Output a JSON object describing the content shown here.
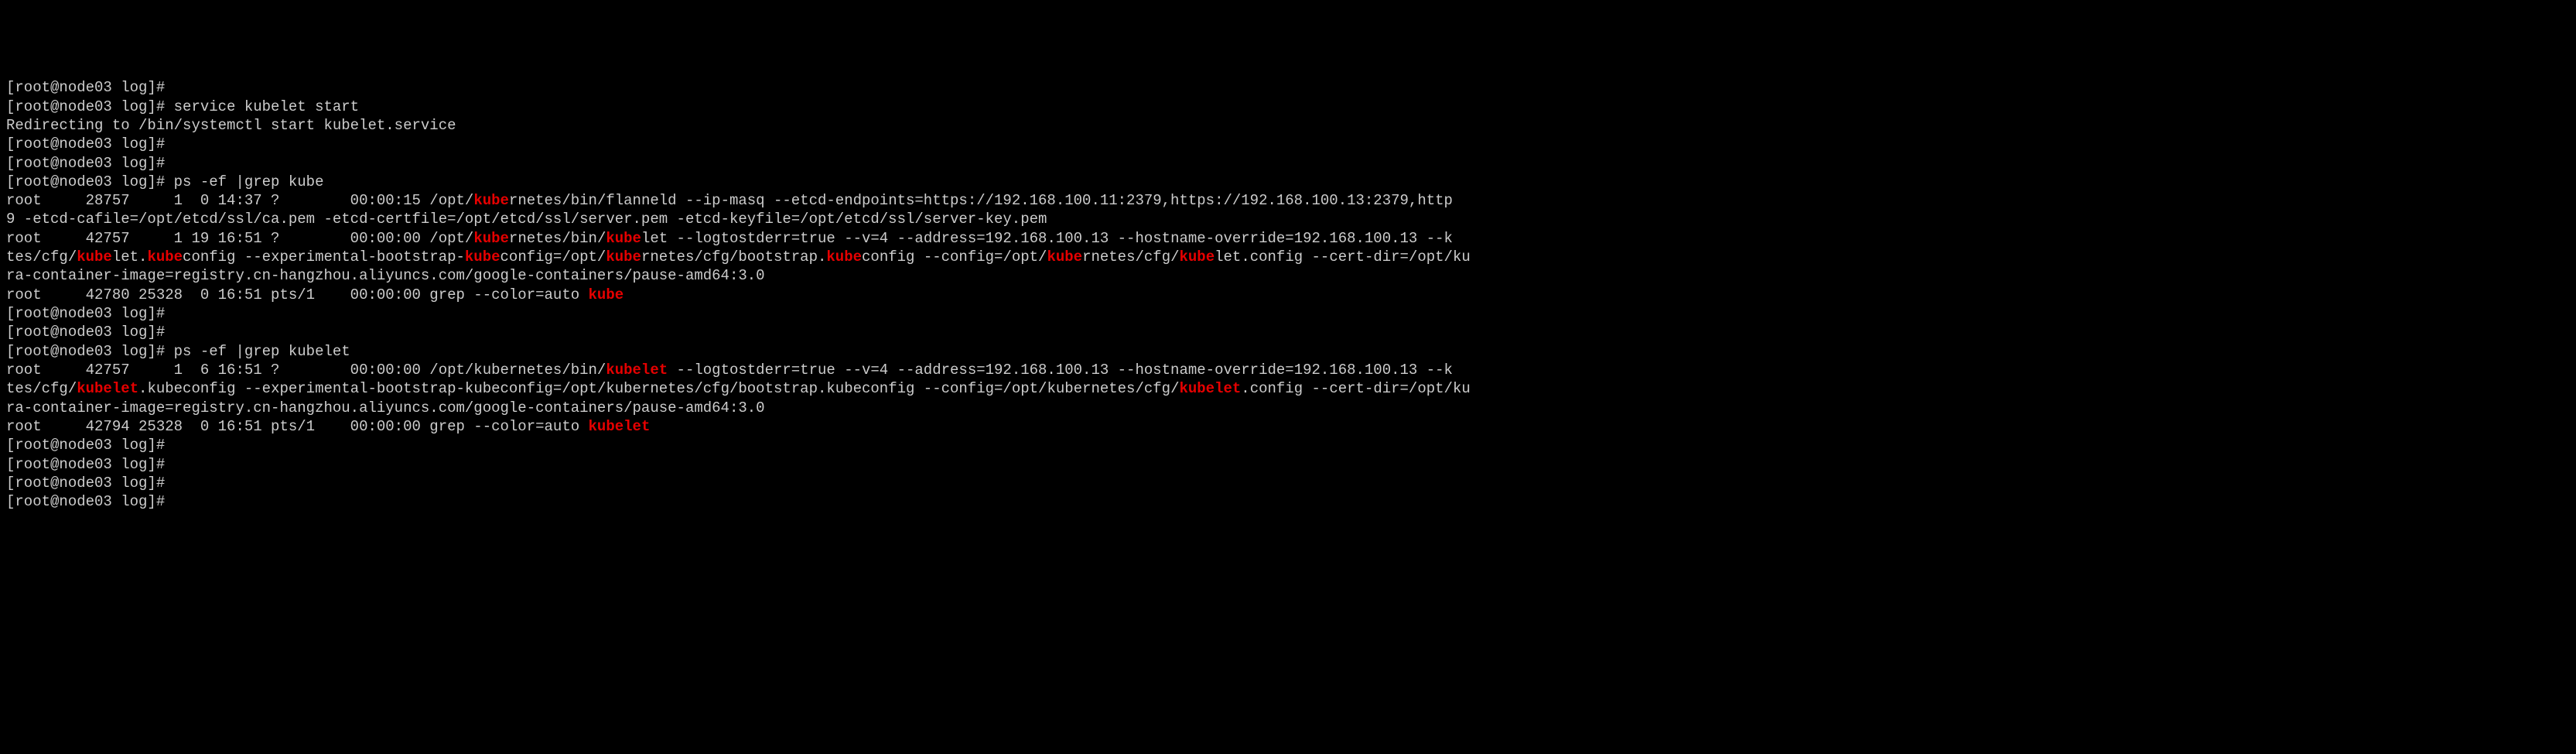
{
  "chart_data": null,
  "prompt": "[root@node03 log]#",
  "cmd": {
    "service": "service kubelet start",
    "redirect": "Redirecting to /bin/systemctl start kubelet.service",
    "ps1": "ps -ef |grep kube",
    "ps2": "ps -ef |grep kubelet"
  },
  "line_flanneld_a": "root     28757     1  0 14:37 ?        00:00:15 /opt/",
  "line_flanneld_b": "rnetes/bin/flanneld --ip-masq --etcd-endpoints=https://192.168.100.11:2379,https://192.168.100.13:2379,http",
  "line_flanneld_2": "9 -etcd-cafile=/opt/etcd/ssl/ca.pem -etcd-certfile=/opt/etcd/ssl/server.pem -etcd-keyfile=/opt/etcd/ssl/server-key.pem",
  "ps1_kubelet_a": "root     42757     1 19 16:51 ?        00:00:00 /opt/",
  "ps1_kubelet_b": "rnetes/bin/",
  "ps1_kubelet_c": "let --logtostderr=true --v=4 --address=192.168.100.13 --hostname-override=192.168.100.13 --k",
  "ps1_kubelet2_a": "tes/cfg/",
  "ps1_kubelet2_b": "let.",
  "ps1_kubelet2_c": "config --experimental-bootstrap-",
  "ps1_kubelet2_d": "config=/opt/",
  "ps1_kubelet2_e": "rnetes/cfg/bootstrap.",
  "ps1_kubelet2_f": "config --config=/opt/",
  "ps1_kubelet2_g": "rnetes/cfg/",
  "ps1_kubelet2_h": "let.config --cert-dir=/opt/ku",
  "cont_image": "ra-container-image=registry.cn-hangzhou.aliyuncs.com/google-containers/pause-amd64:3.0",
  "ps1_grep_a": "root     42780 25328  0 16:51 pts/1    00:00:00 grep --color=auto ",
  "ps2_kubelet_a": "root     42757     1  6 16:51 ?        00:00:00 /opt/kubernetes/bin/",
  "ps2_kubelet_b": " --logtostderr=true --v=4 --address=192.168.100.13 --hostname-override=192.168.100.13 --k",
  "ps2_kubelet2_a": "tes/cfg/",
  "ps2_kubelet2_b": ".kubeconfig --experimental-bootstrap-kubeconfig=/opt/kubernetes/cfg/bootstrap.kubeconfig --config=/opt/kubernetes/cfg/",
  "ps2_kubelet2_c": ".config --cert-dir=/opt/ku",
  "ps2_grep_a": "root     42794 25328  0 16:51 pts/1    00:00:00 grep --color=auto ",
  "hl": {
    "kube": "kube",
    "kubelet": "kubelet"
  }
}
